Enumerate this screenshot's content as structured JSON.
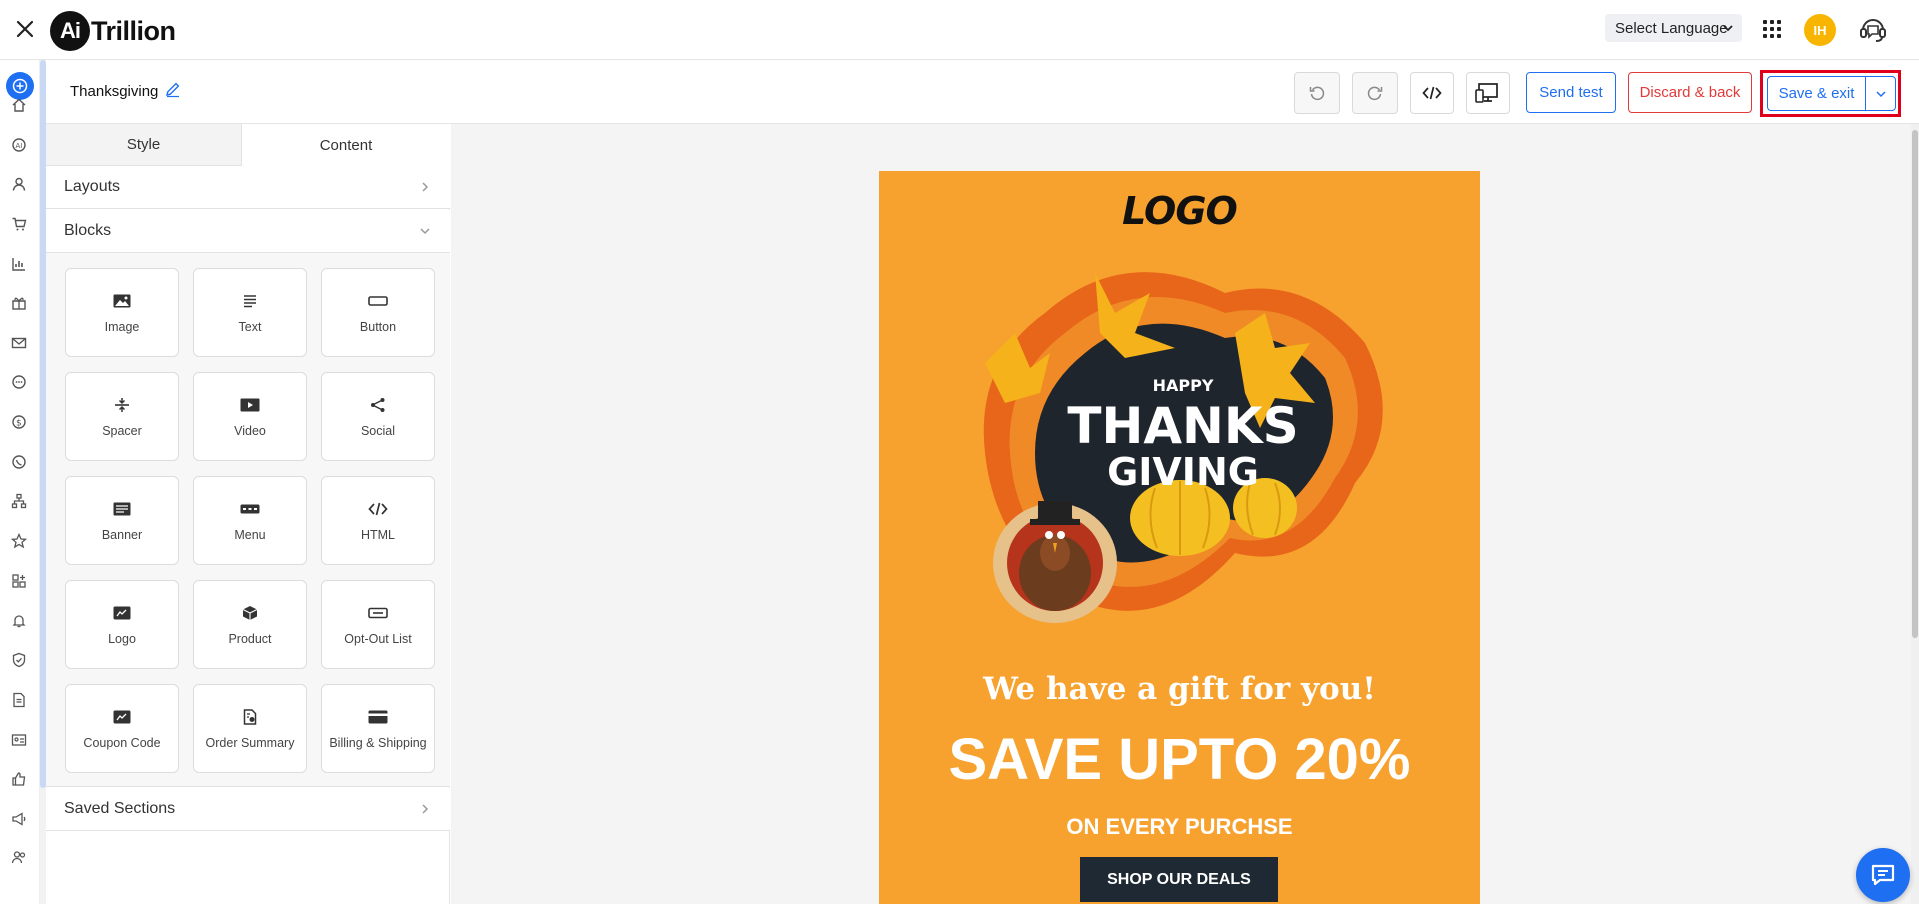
{
  "app": {
    "brand_mark": "Ai",
    "brand_name": "Trillion",
    "language_select": "Select Language",
    "avatar_initials": "IH",
    "accent": "#1e6ff1"
  },
  "editor": {
    "campaign_name": "Thanksgiving",
    "send_test": "Send test",
    "discard_back": "Discard & back",
    "save_exit": "Save & exit"
  },
  "panel": {
    "tabs": [
      "Style",
      "Content"
    ],
    "active_tab": "Content",
    "sections": {
      "layouts": "Layouts",
      "blocks": "Blocks",
      "saved": "Saved Sections"
    },
    "blocks": [
      {
        "label": "Image",
        "icon": "image-icon"
      },
      {
        "label": "Text",
        "icon": "text-icon"
      },
      {
        "label": "Button",
        "icon": "button-icon"
      },
      {
        "label": "Spacer",
        "icon": "spacer-icon"
      },
      {
        "label": "Video",
        "icon": "video-icon"
      },
      {
        "label": "Social",
        "icon": "share-icon"
      },
      {
        "label": "Banner",
        "icon": "banner-icon"
      },
      {
        "label": "Menu",
        "icon": "menu-icon"
      },
      {
        "label": "HTML",
        "icon": "code-icon"
      },
      {
        "label": "Logo",
        "icon": "logo-icon"
      },
      {
        "label": "Product",
        "icon": "product-icon"
      },
      {
        "label": "Opt-Out List",
        "icon": "opt-out-icon"
      },
      {
        "label": "Coupon Code",
        "icon": "coupon-icon"
      },
      {
        "label": "Order Summary",
        "icon": "order-summary-icon"
      },
      {
        "label": "Billing & Shipping",
        "icon": "card-icon"
      }
    ]
  },
  "email": {
    "logo": "LOGO",
    "hero_happy": "HAPPY",
    "hero_thanks": "THANKS",
    "hero_giving": "GIVING",
    "gift_line": "We have a gift for you!",
    "headline": "SAVE UPTO 20%",
    "subline": "ON EVERY PURCHSE",
    "cta": "SHOP OUR DEALS",
    "bg_color": "#f7a22e"
  }
}
